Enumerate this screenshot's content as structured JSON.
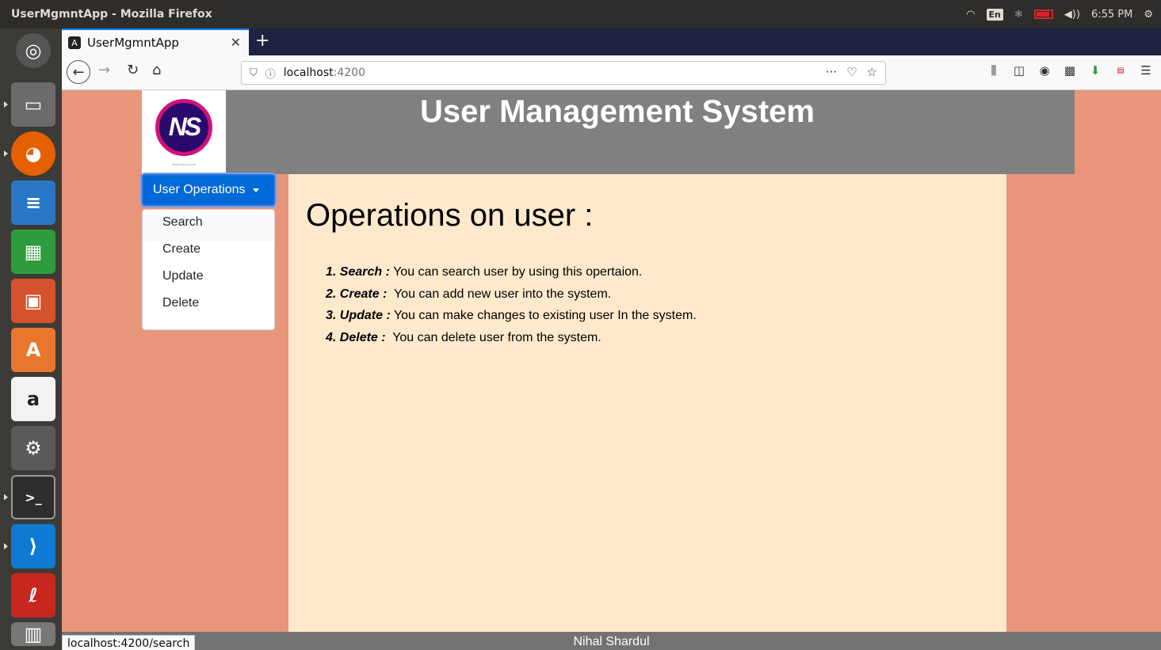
{
  "os": {
    "window_title": "UserMgmntApp - Mozilla Firefox",
    "keyboard_layout": "En",
    "clock": "6:55 PM"
  },
  "launcher": {
    "apps": [
      {
        "name": "ubuntu-dash-icon",
        "color": "#3c3b37"
      },
      {
        "name": "files-icon",
        "color": "#6b6b6b"
      },
      {
        "name": "firefox-icon",
        "color": "#e66000"
      },
      {
        "name": "writer-icon",
        "color": "#2a76c6"
      },
      {
        "name": "calc-icon",
        "color": "#2e9c3d"
      },
      {
        "name": "impress-icon",
        "color": "#d5532c"
      },
      {
        "name": "software-center-icon",
        "color": "#e8762c"
      },
      {
        "name": "amazon-icon",
        "color": "#f2f2f2"
      },
      {
        "name": "system-settings-icon",
        "color": "#5a5a5a"
      },
      {
        "name": "terminal-icon",
        "color": "#2e2e2e"
      },
      {
        "name": "vscode-icon",
        "color": "#0e7ad3"
      },
      {
        "name": "pdf-icon",
        "color": "#c7271f"
      },
      {
        "name": "trash-icon",
        "color": "#777777"
      }
    ]
  },
  "browser": {
    "tab_title": "UserMgmntApp",
    "url_host": "localhost",
    "url_port": ":4200",
    "status_url": "localhost:4200/search"
  },
  "page": {
    "header_title": "User Management System",
    "dropdown_label": "User Operations",
    "menu_items": [
      "Search",
      "Create",
      "Update",
      "Delete"
    ],
    "heading": "Operations on user :",
    "operations": [
      {
        "label": "1. Search :",
        "text": " You can search user by using this opertaion."
      },
      {
        "label": "2. Create :",
        "text": "  You can add new user into the system."
      },
      {
        "label": "3. Update :",
        "text": " You can make changes to existing user In the system."
      },
      {
        "label": "4. Delete :",
        "text": "  You can delete user from the system."
      }
    ],
    "footer_name": "Nihal Shardul",
    "logo_text": "NS"
  },
  "colors": {
    "page_background": "#e9957a",
    "header_background": "#808080",
    "content_background": "#ffe9cc",
    "button_primary": "#0069d9"
  }
}
